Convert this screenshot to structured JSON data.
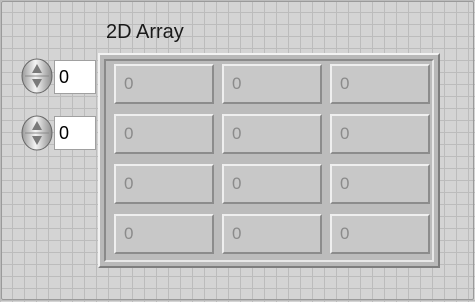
{
  "control": {
    "label": "2D Array"
  },
  "index": {
    "row": "0",
    "column": "0"
  },
  "cells": [
    [
      "0",
      "0",
      "0"
    ],
    [
      "0",
      "0",
      "0"
    ],
    [
      "0",
      "0",
      "0"
    ],
    [
      "0",
      "0",
      "0"
    ]
  ],
  "colors": {
    "panel": "#d4d4d4",
    "grid": "#bcbcbc",
    "cell": "#c8c8c8",
    "disabled_text": "#8b8b8b"
  }
}
